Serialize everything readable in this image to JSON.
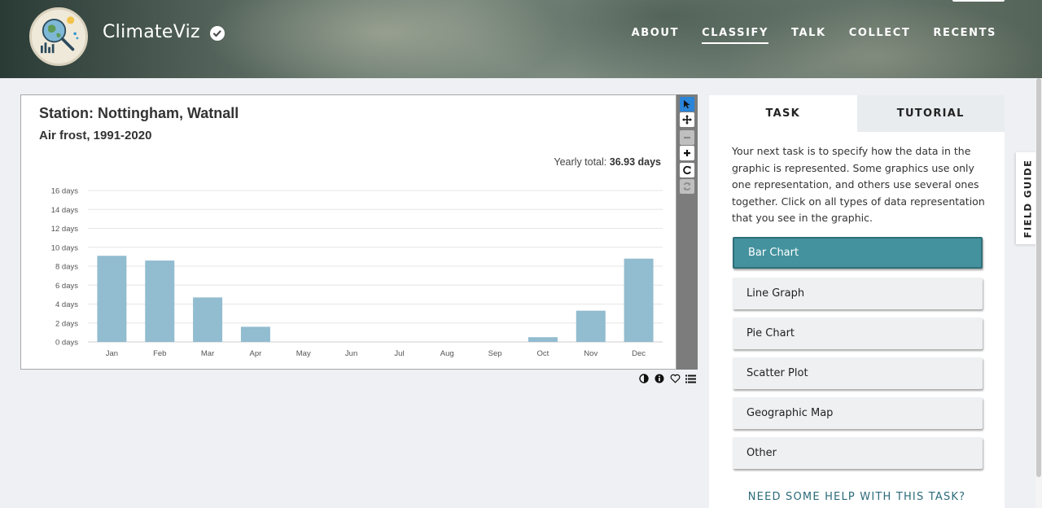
{
  "header": {
    "brand": "ClimateViz",
    "nav": [
      {
        "label": "ABOUT",
        "active": false
      },
      {
        "label": "CLASSIFY",
        "active": true
      },
      {
        "label": "TALK",
        "active": false
      },
      {
        "label": "COLLECT",
        "active": false
      },
      {
        "label": "RECENTS",
        "active": false
      }
    ]
  },
  "subject": {
    "title": "Station: Nottingham, Watnall",
    "subtitle": "Air frost, 1991-2020",
    "yearly_total_label": "Yearly total:",
    "yearly_total_value": "36.93 days"
  },
  "chart_data": {
    "type": "bar",
    "title": "Station: Nottingham, Watnall",
    "subtitle": "Air frost, 1991-2020",
    "categories": [
      "Jan",
      "Feb",
      "Mar",
      "Apr",
      "May",
      "Jun",
      "Jul",
      "Aug",
      "Sep",
      "Oct",
      "Nov",
      "Dec"
    ],
    "values": [
      9.1,
      8.6,
      4.7,
      1.6,
      0,
      0,
      0,
      0,
      0,
      0.5,
      3.3,
      8.8
    ],
    "yticks": [
      "0 days",
      "2 days",
      "4 days",
      "6 days",
      "8 days",
      "10 days",
      "12 days",
      "14 days",
      "16 days"
    ],
    "ylim": [
      0,
      16
    ],
    "bar_color": "#92bccf",
    "grid": true
  },
  "toolbar": {
    "icons": [
      "pointer-icon",
      "move-icon",
      "zoom-out-icon",
      "zoom-in-icon",
      "rotate-icon",
      "reset-icon"
    ]
  },
  "viewer_actions": [
    "invert-icon",
    "info-icon",
    "favorite-icon",
    "collections-icon"
  ],
  "task": {
    "tabs": [
      {
        "label": "TASK",
        "active": true
      },
      {
        "label": "TUTORIAL",
        "active": false
      }
    ],
    "question": "Your next task is to specify how the data in the graphic is represented. Some graphics use only one representation, and others use several ones together. Click on all types of data representation that you see in the graphic.",
    "answers": [
      {
        "label": "Bar Chart",
        "selected": true
      },
      {
        "label": "Line Graph",
        "selected": false
      },
      {
        "label": "Pie Chart",
        "selected": false
      },
      {
        "label": "Scatter Plot",
        "selected": false
      },
      {
        "label": "Geographic Map",
        "selected": false
      },
      {
        "label": "Other",
        "selected": false
      }
    ],
    "help_link": "NEED SOME HELP WITH THIS TASK?"
  },
  "field_guide": "FIELD GUIDE",
  "colors": {
    "accent": "#43929e",
    "link": "#2b6b7a",
    "toolbar_active": "#2a84d8"
  }
}
